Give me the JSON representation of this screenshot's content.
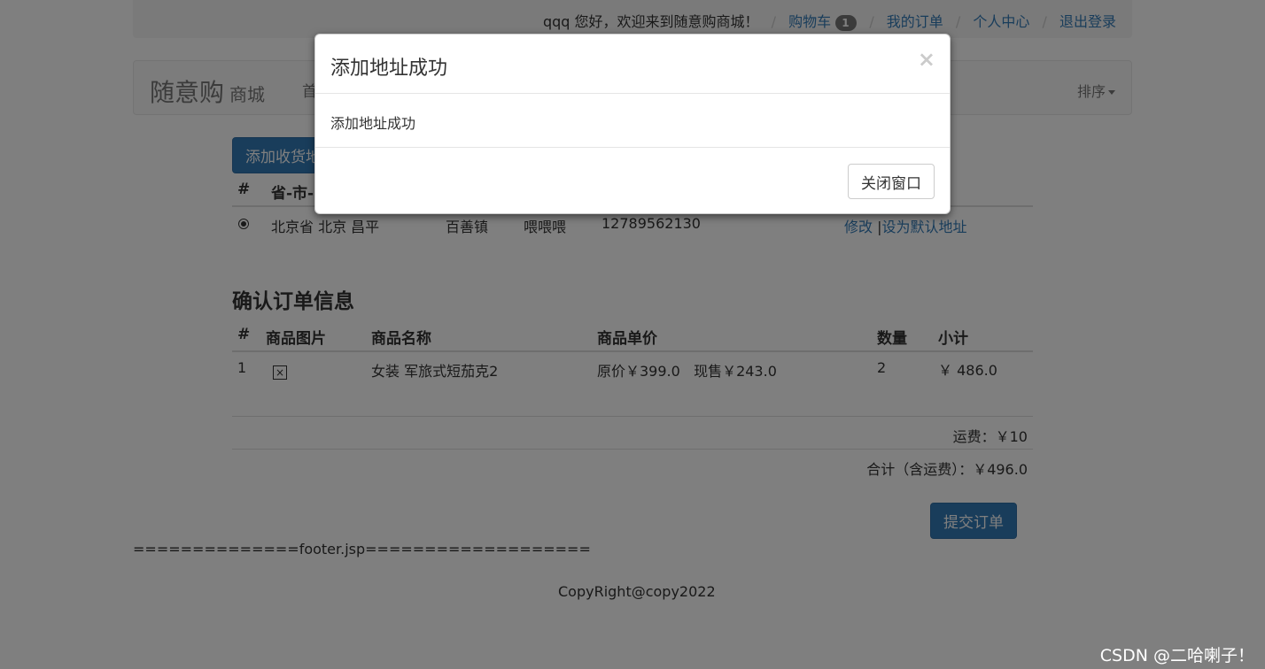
{
  "header": {
    "greeting": "qqq 您好，欢迎来到随意购商城！",
    "cart_label": "购物车",
    "cart_count": "1",
    "orders_label": "我的订单",
    "profile_label": "个人中心",
    "logout_label": "退出登录"
  },
  "navbar": {
    "brand": "随意购",
    "brand_sub": "商城",
    "home_link": "首",
    "sort_label": "排序"
  },
  "address": {
    "add_button": "添加收货地",
    "columns": [
      "#",
      "省-市-"
    ],
    "row": {
      "region": "北京省 北京 昌平",
      "town": "百善镇",
      "name": "喂喂喂",
      "phone": "12789562130",
      "edit_link": "修改",
      "default_link": "设为默认地址"
    }
  },
  "order": {
    "title": "确认订单信息",
    "columns": [
      "#",
      "商品图片",
      "商品名称",
      "商品单价",
      "数量",
      "小计"
    ],
    "items": [
      {
        "index": "1",
        "name": "女装 军旅式短茄克2",
        "price": "原价￥399.0   现售￥243.0",
        "quantity": "2",
        "subtotal": "￥ 486.0"
      }
    ],
    "shipping": "运费：￥10",
    "total": "合计（含运费）：￥496.0",
    "submit_button": "提交订单"
  },
  "footer": {
    "marker": "==============footer.jsp===================",
    "copyright": "CopyRight@copy2022"
  },
  "modal": {
    "title": "添加地址成功",
    "body": "添加地址成功",
    "close_symbol": "×",
    "close_button": "关闭窗口"
  },
  "watermark": "CSDN @二哈喇子！"
}
